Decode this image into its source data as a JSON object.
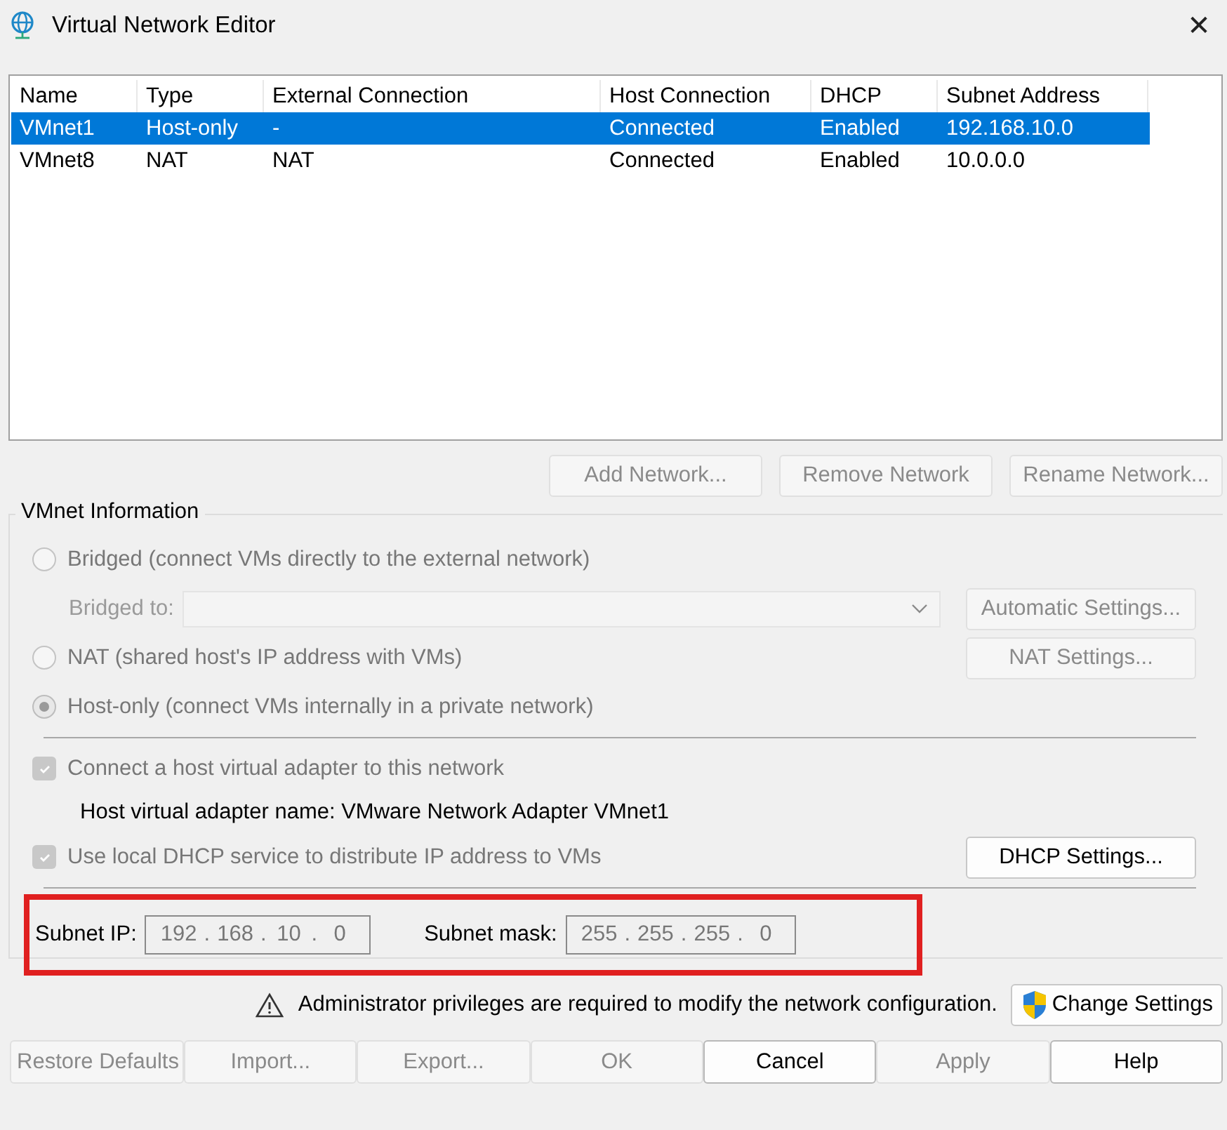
{
  "window": {
    "title": "Virtual Network Editor",
    "close": "✕"
  },
  "table": {
    "columns": [
      "Name",
      "Type",
      "External Connection",
      "Host Connection",
      "DHCP",
      "Subnet Address"
    ],
    "rows": [
      {
        "selected": true,
        "cells": [
          "VMnet1",
          "Host-only",
          "-",
          "Connected",
          "Enabled",
          "192.168.10.0"
        ]
      },
      {
        "selected": false,
        "cells": [
          "VMnet8",
          "NAT",
          "NAT",
          "Connected",
          "Enabled",
          "10.0.0.0"
        ]
      }
    ]
  },
  "network_buttons": [
    {
      "label": "Add Network...",
      "disabled": true
    },
    {
      "label": "Remove Network",
      "disabled": true
    },
    {
      "label": "Rename Network...",
      "disabled": true
    }
  ],
  "vmnet_info": {
    "title": "VMnet Information",
    "options": [
      {
        "kind": "radio",
        "label": "Bridged (connect VMs directly to the external network)",
        "selected": false,
        "disabled": true
      },
      {
        "kind": "dropdown",
        "label": "Bridged to:",
        "disabled": true,
        "button": {
          "label": "Automatic Settings...",
          "disabled": true
        }
      },
      {
        "kind": "radio",
        "label": "NAT (shared host's IP address with VMs)",
        "selected": false,
        "disabled": true,
        "button": {
          "label": "NAT Settings...",
          "disabled": true
        }
      },
      {
        "kind": "radio",
        "label": "Host-only (connect VMs internally in a private network)",
        "selected": true,
        "disabled": true
      }
    ],
    "adapter": {
      "label": "Connect a host virtual adapter to this network",
      "checked": true,
      "disabled": true
    },
    "adapter_name": "Host virtual adapter name: VMware Network Adapter VMnet1",
    "dhcp": {
      "label": "Use local DHCP service to distribute IP address to VMs",
      "checked": true,
      "disabled": true,
      "button": {
        "label": "DHCP Settings...",
        "disabled": false
      }
    },
    "subnet_ip": {
      "label": "Subnet IP:",
      "octets": [
        "192",
        "168",
        "10",
        "0"
      ]
    },
    "subnet_mask": {
      "label": "Subnet mask:",
      "octets": [
        "255",
        "255",
        "255",
        "0"
      ]
    },
    "separator": "."
  },
  "notice": "Administrator privileges are required to modify the network configuration.",
  "change_settings": "Change Settings",
  "footer_buttons": [
    {
      "label": "Restore Defaults",
      "disabled": true
    },
    {
      "label": "Import...",
      "disabled": true
    },
    {
      "label": "Export...",
      "disabled": true
    },
    {
      "label": "OK",
      "disabled": true
    },
    {
      "label": "Cancel",
      "disabled": false
    },
    {
      "label": "Apply",
      "disabled": true
    },
    {
      "label": "Help",
      "disabled": false
    }
  ]
}
